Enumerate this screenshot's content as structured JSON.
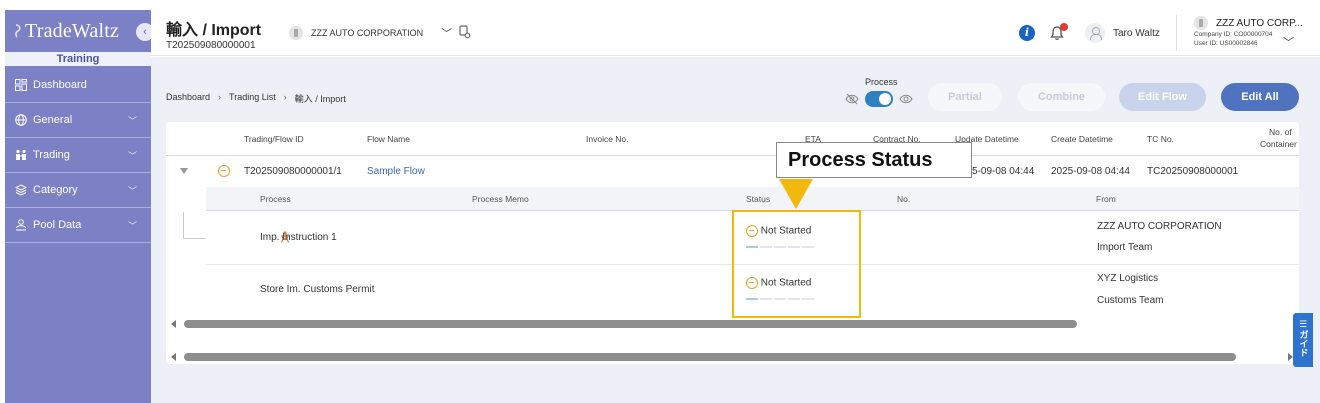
{
  "brand": {
    "name": "TradeWaltz",
    "environment": "Training",
    "collapse_glyph": "‹"
  },
  "sidebar": {
    "items": [
      {
        "label": "Dashboard",
        "icon": "dashboard-icon",
        "expandable": false
      },
      {
        "label": "General",
        "icon": "globe-icon",
        "expandable": true
      },
      {
        "label": "Trading",
        "icon": "trading-icon",
        "expandable": true
      },
      {
        "label": "Category",
        "icon": "layers-icon",
        "expandable": true
      },
      {
        "label": "Pool Data",
        "icon": "user-stack-icon",
        "expandable": true
      }
    ]
  },
  "header": {
    "title": "輸入 / Import",
    "trade_id": "T202509080000001",
    "company": "ZZZ AUTO CORPORATION",
    "user_name": "Taro Waltz",
    "account": {
      "company_name": "ZZZ AUTO CORP...",
      "company_id": "Company ID: CO00000704",
      "user_id": "User ID: US00002846"
    },
    "info_glyph": "i"
  },
  "breadcrumb": [
    "Dashboard",
    "Trading List",
    "輸入 / Import"
  ],
  "breadcrumb_separator": "›",
  "process_toggle": {
    "label": "Process",
    "on": true
  },
  "buttons": {
    "partial": "Partial",
    "combine": "Combine",
    "edit_flow": "Edit Flow",
    "edit_all": "Edit All"
  },
  "table": {
    "columns": [
      "Trading/Flow ID",
      "Flow Name",
      "Invoice No.",
      "ETA",
      "Contract No.",
      "Update Datetime",
      "Create Datetime",
      "TC No.",
      "No. of",
      "Container"
    ],
    "row": {
      "flow_id": "T202509080000001/1",
      "flow_name": "Sample Flow",
      "update_datetime": "5-09-08 04:44",
      "create_datetime": "2025-09-08 04:44",
      "tc_no": "TC20250908000001"
    },
    "process_columns": [
      "Process",
      "Process Memo",
      "Status",
      "No.",
      "From"
    ],
    "processes": [
      {
        "name": "Imp. Instruction 1",
        "status": "Not Started",
        "from_company": "ZZZ AUTO CORPORATION",
        "from_team": "Import Team"
      },
      {
        "name": "Store Im. Customs Permit",
        "status": "Not Started",
        "from_company": "XYZ Logistics",
        "from_team": "Customs Team"
      }
    ]
  },
  "annotation": {
    "callout": "Process Status"
  },
  "guide_tab": {
    "label": "ガイド"
  },
  "colors": {
    "sidebar": "#7b81c4",
    "accent": "#4f73be",
    "highlight": "#f2b90c",
    "status_icon": "#e3a329",
    "link": "#3a67b1"
  }
}
